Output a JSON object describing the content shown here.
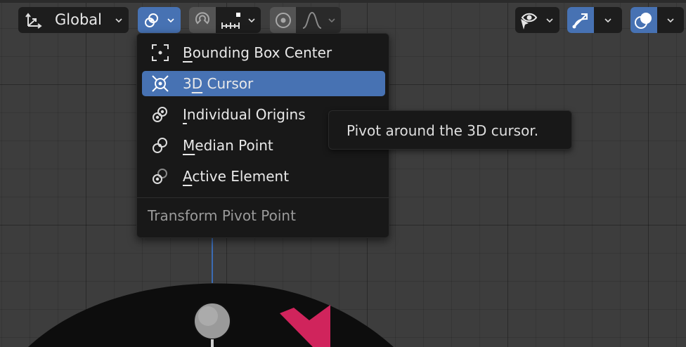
{
  "toolbar": {
    "orientation_label": "Global"
  },
  "pivot_menu": {
    "items": [
      {
        "pre": "",
        "ul": "B",
        "post": "ounding Box Center",
        "icon": "bounding-box-center-icon",
        "active": false
      },
      {
        "pre": "3",
        "ul": "D",
        "post": " Cursor",
        "icon": "3d-cursor-icon",
        "active": true
      },
      {
        "pre": "",
        "ul": "I",
        "post": "ndividual Origins",
        "icon": "individual-origins-icon",
        "active": false
      },
      {
        "pre": "",
        "ul": "M",
        "post": "edian Point",
        "icon": "median-point-icon",
        "active": false
      },
      {
        "pre": "",
        "ul": "A",
        "post": "ctive Element",
        "icon": "active-element-icon",
        "active": false
      }
    ],
    "title": "Transform Pivot Point"
  },
  "tooltip": {
    "text": "Pivot around the 3D cursor."
  },
  "colors": {
    "accent": "#4772b3",
    "background": "#3d3d3d",
    "menu_bg": "#181818",
    "object_mark": "#d0245c"
  }
}
